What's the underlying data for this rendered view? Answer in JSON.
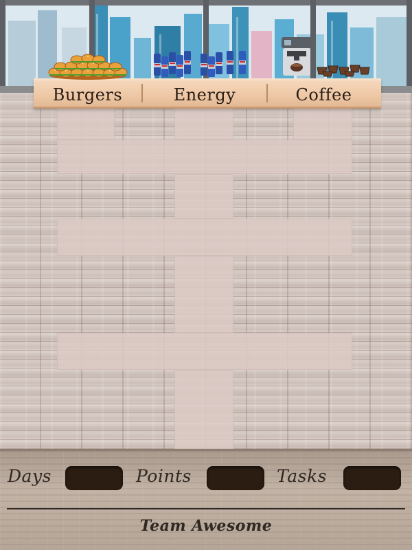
{
  "counter": {
    "stations": [
      {
        "label": "Burgers",
        "item": "burger-pile"
      },
      {
        "label": "Energy",
        "item": "energy-cans"
      },
      {
        "label": "Coffee",
        "item": "coffee-machine"
      }
    ]
  },
  "stats": {
    "days_label": "Days",
    "days_value": "",
    "points_label": "Points",
    "points_value": "",
    "tasks_label": "Tasks",
    "tasks_value": ""
  },
  "team": {
    "name": "Team Awesome"
  },
  "colors": {
    "counter": "#eec8a6",
    "stat_box": "#2b1d12",
    "panel": "#b7a89c",
    "tile": "#dccac4"
  }
}
